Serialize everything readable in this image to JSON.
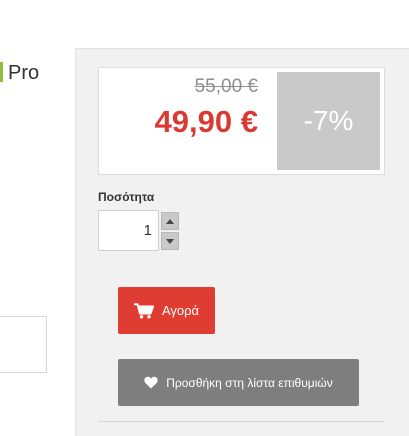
{
  "product": {
    "title_fragment": "Pro"
  },
  "pricing": {
    "old_price": "55,00 €",
    "new_price": "49,90 €",
    "discount": "-7%"
  },
  "quantity": {
    "label": "Ποσότητα",
    "value": "1"
  },
  "actions": {
    "buy_label": "Αγορά",
    "wishlist_label": "Προσθήκη στη λίστα επιθυμιών"
  },
  "colors": {
    "accent_red": "#df3d31",
    "price_red": "#d93b32",
    "wishlist_gray": "#7e7e7e",
    "discount_gray": "#c9c9c9",
    "panel_bg": "#f1f1f1"
  },
  "icons": {
    "buy": "shopping-cart-icon",
    "wishlist": "heart-icon",
    "qty_up": "triangle-up-icon",
    "qty_down": "triangle-down-icon"
  }
}
